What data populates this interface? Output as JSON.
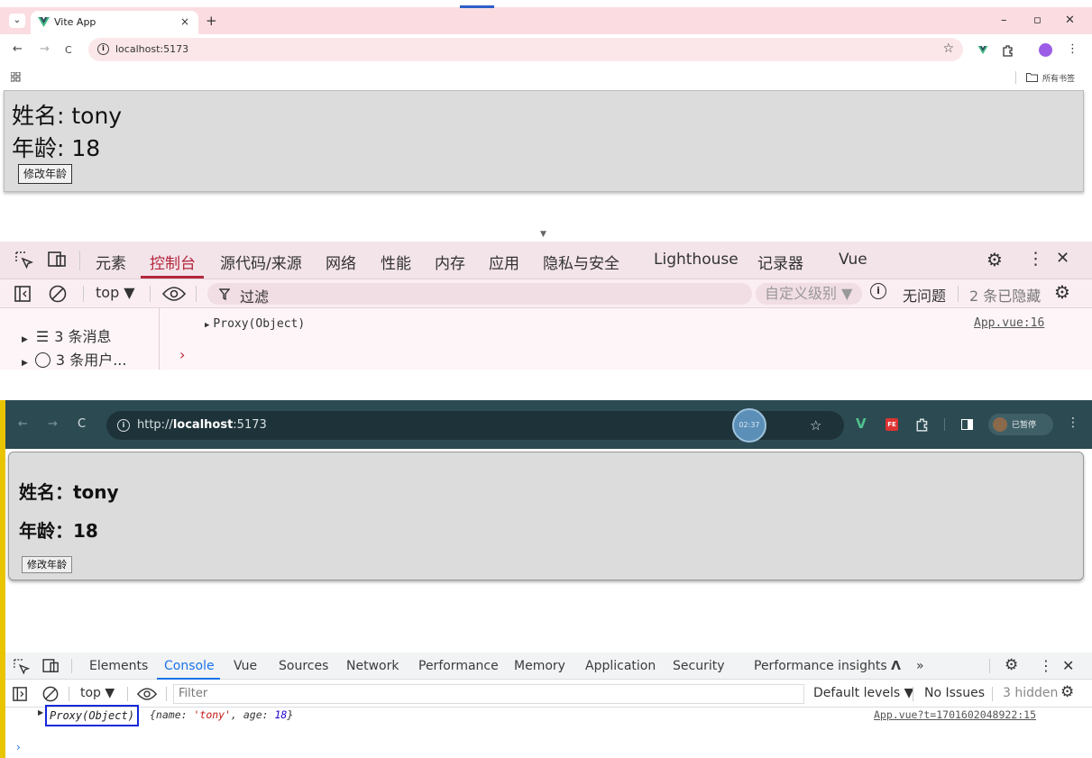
{
  "top": {
    "tab_title": "Vite App",
    "tab_close": "×",
    "new_tab": "+",
    "win_min": "–",
    "win_max": "▫",
    "win_close": "✕",
    "nav_back": "←",
    "nav_forward": "→",
    "nav_reload": "C",
    "url": "localhost:5173",
    "bookmarks_all": "所有书签",
    "page": {
      "name_line": "姓名: tony",
      "age_line": "年龄: 18",
      "button": "修改年龄"
    },
    "devtools": {
      "tabs": [
        "元素",
        "控制台",
        "源代码/来源",
        "网络",
        "性能",
        "内存",
        "应用",
        "隐私与安全",
        "Lighthouse",
        "记录器",
        "Vue"
      ],
      "active_tab": "控制台",
      "context": "top ▼",
      "filter_label": "过滤",
      "levels": "自定义级别 ▼",
      "issues": "无问题",
      "hidden": "2 条已隐藏",
      "sidebar": [
        "3 条消息",
        "3 条用户..."
      ],
      "log": "Proxy(Object)",
      "source": "App.vue:16",
      "prompt": "›"
    }
  },
  "bottom": {
    "url_prefix": "http://",
    "url_host": "localhost",
    "url_port": ":5173",
    "clock": "02:37",
    "profile": "已暂停",
    "page": {
      "name_line": "姓名：tony",
      "age_line": "年龄：18",
      "button": "修改年龄"
    },
    "devtools": {
      "tabs": [
        "Elements",
        "Console",
        "Vue",
        "Sources",
        "Network",
        "Performance",
        "Memory",
        "Application",
        "Security",
        "Performance insights 𝝠",
        "»"
      ],
      "active_tab": "Console",
      "context": "top ▼",
      "filter_placeholder": "Filter",
      "levels": "Default levels ▼",
      "issues": "No Issues",
      "hidden": "3 hidden",
      "log_proxy": "Proxy(Object)",
      "log_obj_open": "{name: ",
      "log_name": "'tony'",
      "log_mid": ", age: ",
      "log_age": "18",
      "log_close": "}",
      "source": "App.vue?t=1701602048922:15",
      "prompt": "›"
    }
  },
  "colors": {
    "top_tabstrip": "#fbdde1",
    "devtools_active_red": "#b4263c",
    "devtools_active_blue": "#1a73e8",
    "highlight_box": "#1528d8",
    "dark_toolbar": "#2c4a52"
  }
}
